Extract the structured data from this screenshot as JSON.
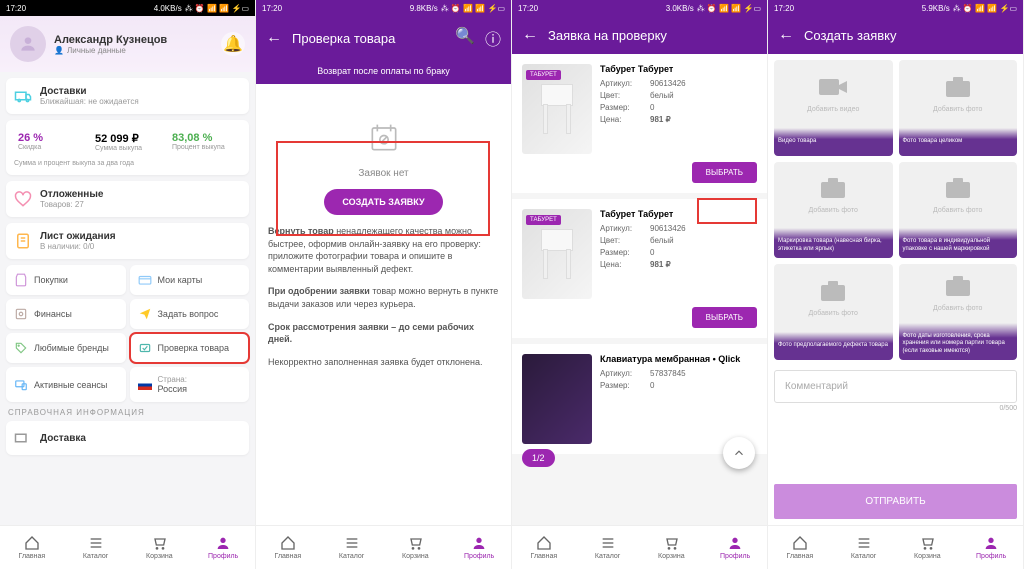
{
  "status": {
    "time": "17:20",
    "net": [
      "4.0KB/s",
      "9.8KB/s",
      "3.0KB/s",
      "5.9KB/s"
    ],
    "icons": "⁂ ⏰ ⚙ 📶 📶 ⚡ 🔋"
  },
  "nav": {
    "items": [
      "Главная",
      "Каталог",
      "Корзина",
      "Профиль"
    ]
  },
  "s1": {
    "name": "Александр Кузнецов",
    "personal": "Личные данные",
    "delivery": {
      "title": "Доставки",
      "sub": "Ближайшая: не ожидается"
    },
    "stats": {
      "discount_val": "26 %",
      "discount_lbl": "Скидка",
      "sum_val": "52 099 ₽",
      "sum_lbl": "Сумма выкупа",
      "percent_val": "83,08 %",
      "percent_lbl": "Процент выкупа",
      "note": "Сумма и процент выкупа за два года"
    },
    "deferred": {
      "title": "Отложенные",
      "sub": "Товаров: 27"
    },
    "waitlist": {
      "title": "Лист ожидания",
      "sub": "В наличии: 0/0"
    },
    "tiles": {
      "purchases": "Покупки",
      "cards": "Мои карты",
      "finance": "Финансы",
      "ask": "Задать вопрос",
      "brands": "Любимые бренды",
      "check": "Проверка товара",
      "sessions": "Активные сеансы",
      "country_lbl": "Страна:",
      "country_val": "Россия"
    },
    "ref_header": "СПРАВОЧНАЯ ИНФОРМАЦИЯ",
    "ref_delivery": "Доставка"
  },
  "s2": {
    "title": "Проверка товара",
    "tab": "Возврат после оплаты по браку",
    "empty": "Заявок нет",
    "create_btn": "СОЗДАТЬ ЗАЯВКУ",
    "p1a": "Вернуть товар",
    "p1b": " ненадлежащего качества можно быстрее, оформив онлайн-заявку на его проверку: приложите фотографии товара и опишите в комментарии выявленный дефект.",
    "p2a": "При одобрении заявки",
    "p2b": " товар можно вернуть в пункте выдачи заказов или через курьера.",
    "p3": "Срок рассмотрения заявки – до семи рабочих дней.",
    "p4": "Некорректно заполненная заявка будет отклонена."
  },
  "s3": {
    "title": "Заявка на проверку",
    "products": [
      {
        "name": "Табурет Табурет",
        "badge": "ТАБУРЕТ",
        "article": "90613426",
        "color": "белый",
        "size": "0",
        "price": "981 ₽",
        "kb": false
      },
      {
        "name": "Табурет Табурет",
        "badge": "ТАБУРЕТ",
        "article": "90613426",
        "color": "белый",
        "size": "0",
        "price": "981 ₽",
        "kb": false
      },
      {
        "name": "Клавиатура мембранная • Qlick",
        "badge": "",
        "article": "57837845",
        "color": "",
        "size": "0",
        "price": "",
        "kb": true
      }
    ],
    "lbl": {
      "article": "Артикул:",
      "color": "Цвет:",
      "size": "Размер:",
      "price": "Цена:"
    },
    "select_btn": "ВЫБРАТЬ",
    "page": "1/2"
  },
  "s4": {
    "title": "Создать заявку",
    "tiles": [
      {
        "label": "Добавить видео",
        "caption": "Видео товара",
        "video": true
      },
      {
        "label": "Добавить фото",
        "caption": "Фото товара целиком",
        "video": false
      },
      {
        "label": "Добавить фото",
        "caption": "Маркировка товара (навесная бирка, этикетка или ярлык)",
        "video": false
      },
      {
        "label": "Добавить фото",
        "caption": "Фото товара в индивидуальной упаковке с нашей маркировкой",
        "video": false
      },
      {
        "label": "Добавить фото",
        "caption": "Фото предполагаемого дефекта товара",
        "video": false
      },
      {
        "label": "Добавить фото",
        "caption": "Фото даты изготовления, срока хранения или номера партии товара (если таковые имеются)",
        "video": false
      }
    ],
    "comment_placeholder": "Комментарий",
    "char_count": "0/500",
    "submit": "ОТПРАВИТЬ"
  }
}
